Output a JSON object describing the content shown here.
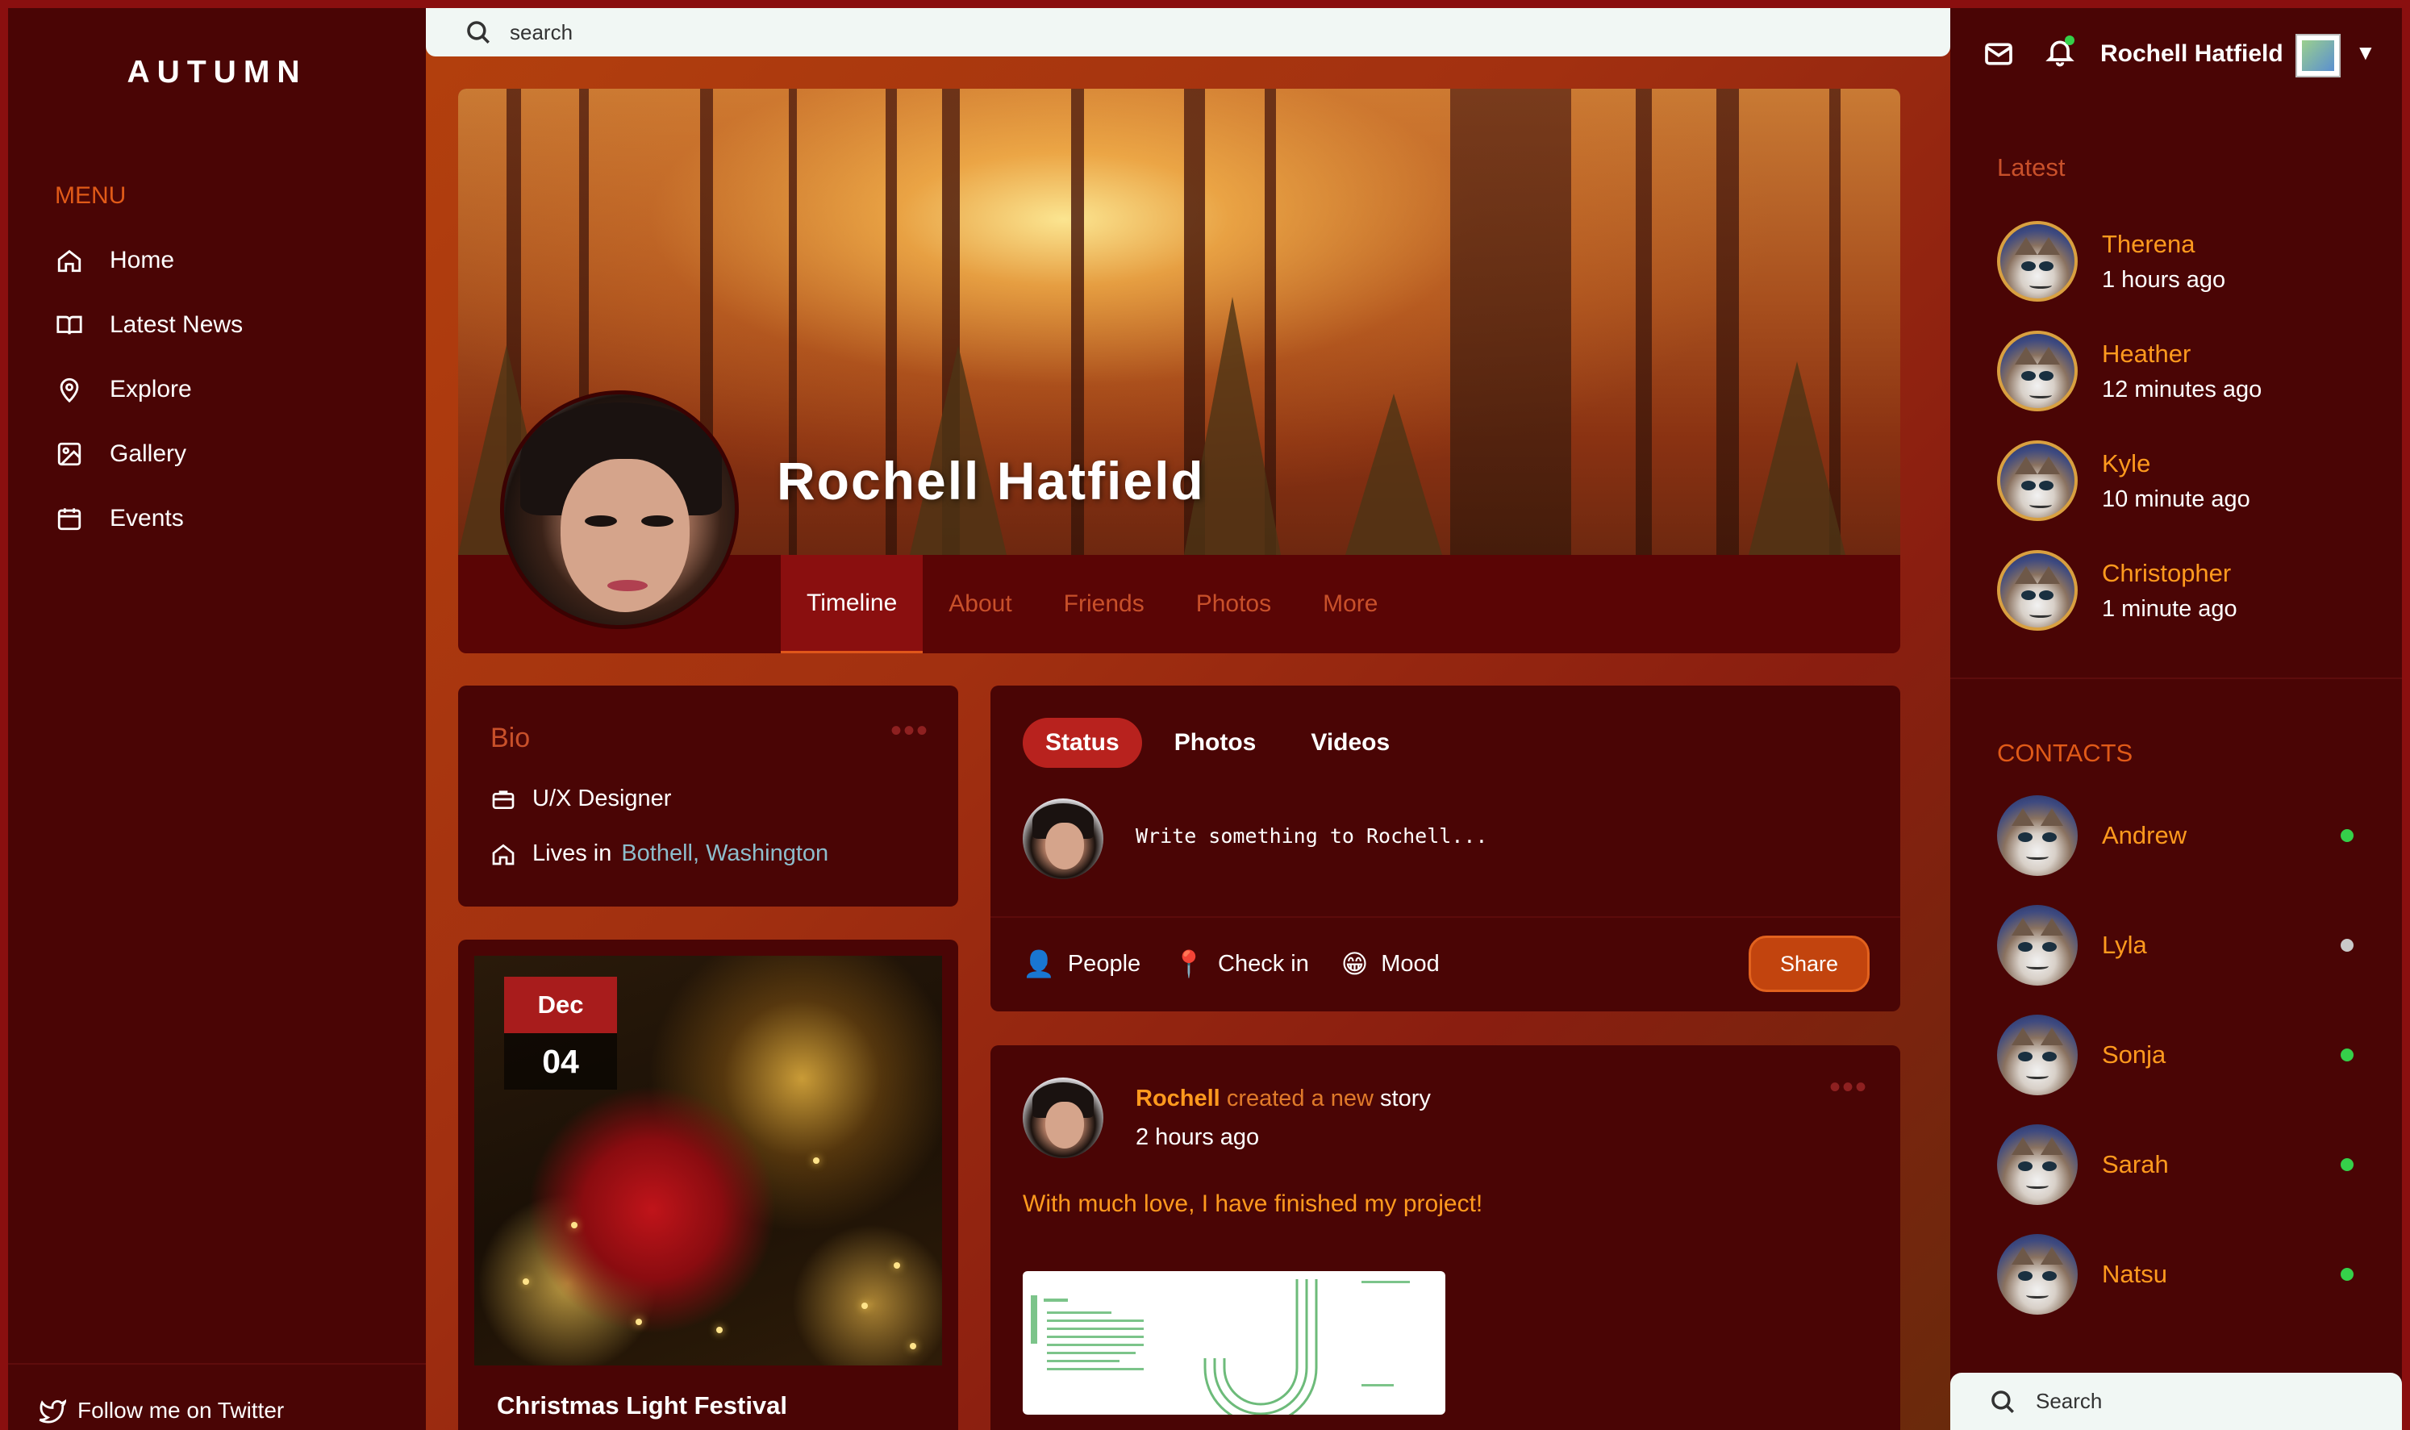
{
  "app": {
    "logo": "AUTUMN"
  },
  "search": {
    "placeholder": "search"
  },
  "sidebar": {
    "menu_title": "MENU",
    "items": [
      {
        "label": "Home",
        "icon": "home-icon"
      },
      {
        "label": "Latest News",
        "icon": "book-icon"
      },
      {
        "label": "Explore",
        "icon": "map-pin-icon"
      },
      {
        "label": "Gallery",
        "icon": "image-icon"
      },
      {
        "label": "Events",
        "icon": "calendar-icon"
      }
    ],
    "footer_link": "Follow me on Twitter"
  },
  "profile": {
    "name": "Rochell Hatfield",
    "tabs": [
      {
        "label": "Timeline",
        "active": true
      },
      {
        "label": "About",
        "active": false
      },
      {
        "label": "Friends",
        "active": false
      },
      {
        "label": "Photos",
        "active": false
      },
      {
        "label": "More",
        "active": false
      }
    ]
  },
  "bio": {
    "title": "Bio",
    "more": "•••",
    "job": "U/X Designer",
    "lives_prefix": "Lives in",
    "location": "Bothell, Washington"
  },
  "event": {
    "month": "Dec",
    "day": "04",
    "title": "Christmas Light Festival"
  },
  "composer": {
    "tabs": [
      {
        "label": "Status",
        "active": true
      },
      {
        "label": "Photos",
        "active": false
      },
      {
        "label": "Videos",
        "active": false
      }
    ],
    "placeholder": "Write something to Rochell...",
    "actions": [
      {
        "label": "People",
        "emoji": "👤"
      },
      {
        "label": "Check in",
        "emoji": "📍"
      },
      {
        "label": "Mood",
        "emoji": "😁"
      }
    ],
    "share_label": "Share"
  },
  "post": {
    "author": "Rochell",
    "action_text": "created a new",
    "object": "story",
    "time": "2 hours ago",
    "text": "With much love, I have finished my project!",
    "more": "•••"
  },
  "topbar": {
    "user_name": "Rochell Hatfield",
    "caret": "▼"
  },
  "latest": {
    "title": "Latest",
    "people": [
      {
        "name": "Therena",
        "time": "1 hours ago"
      },
      {
        "name": "Heather",
        "time": "12 minutes ago"
      },
      {
        "name": "Kyle",
        "time": "10 minute ago"
      },
      {
        "name": "Christopher",
        "time": "1 minute ago"
      }
    ]
  },
  "contacts": {
    "title": "CONTACTS",
    "people": [
      {
        "name": "Andrew",
        "status": "online"
      },
      {
        "name": "Lyla",
        "status": "away"
      },
      {
        "name": "Sonja",
        "status": "online"
      },
      {
        "name": "Sarah",
        "status": "online"
      },
      {
        "name": "Natsu",
        "status": "online"
      }
    ],
    "search_placeholder": "Search"
  },
  "colors": {
    "accent": "#e05a18",
    "online": "#35d04a",
    "away": "#c9c9c9",
    "highlight": "#ff9a1e"
  }
}
